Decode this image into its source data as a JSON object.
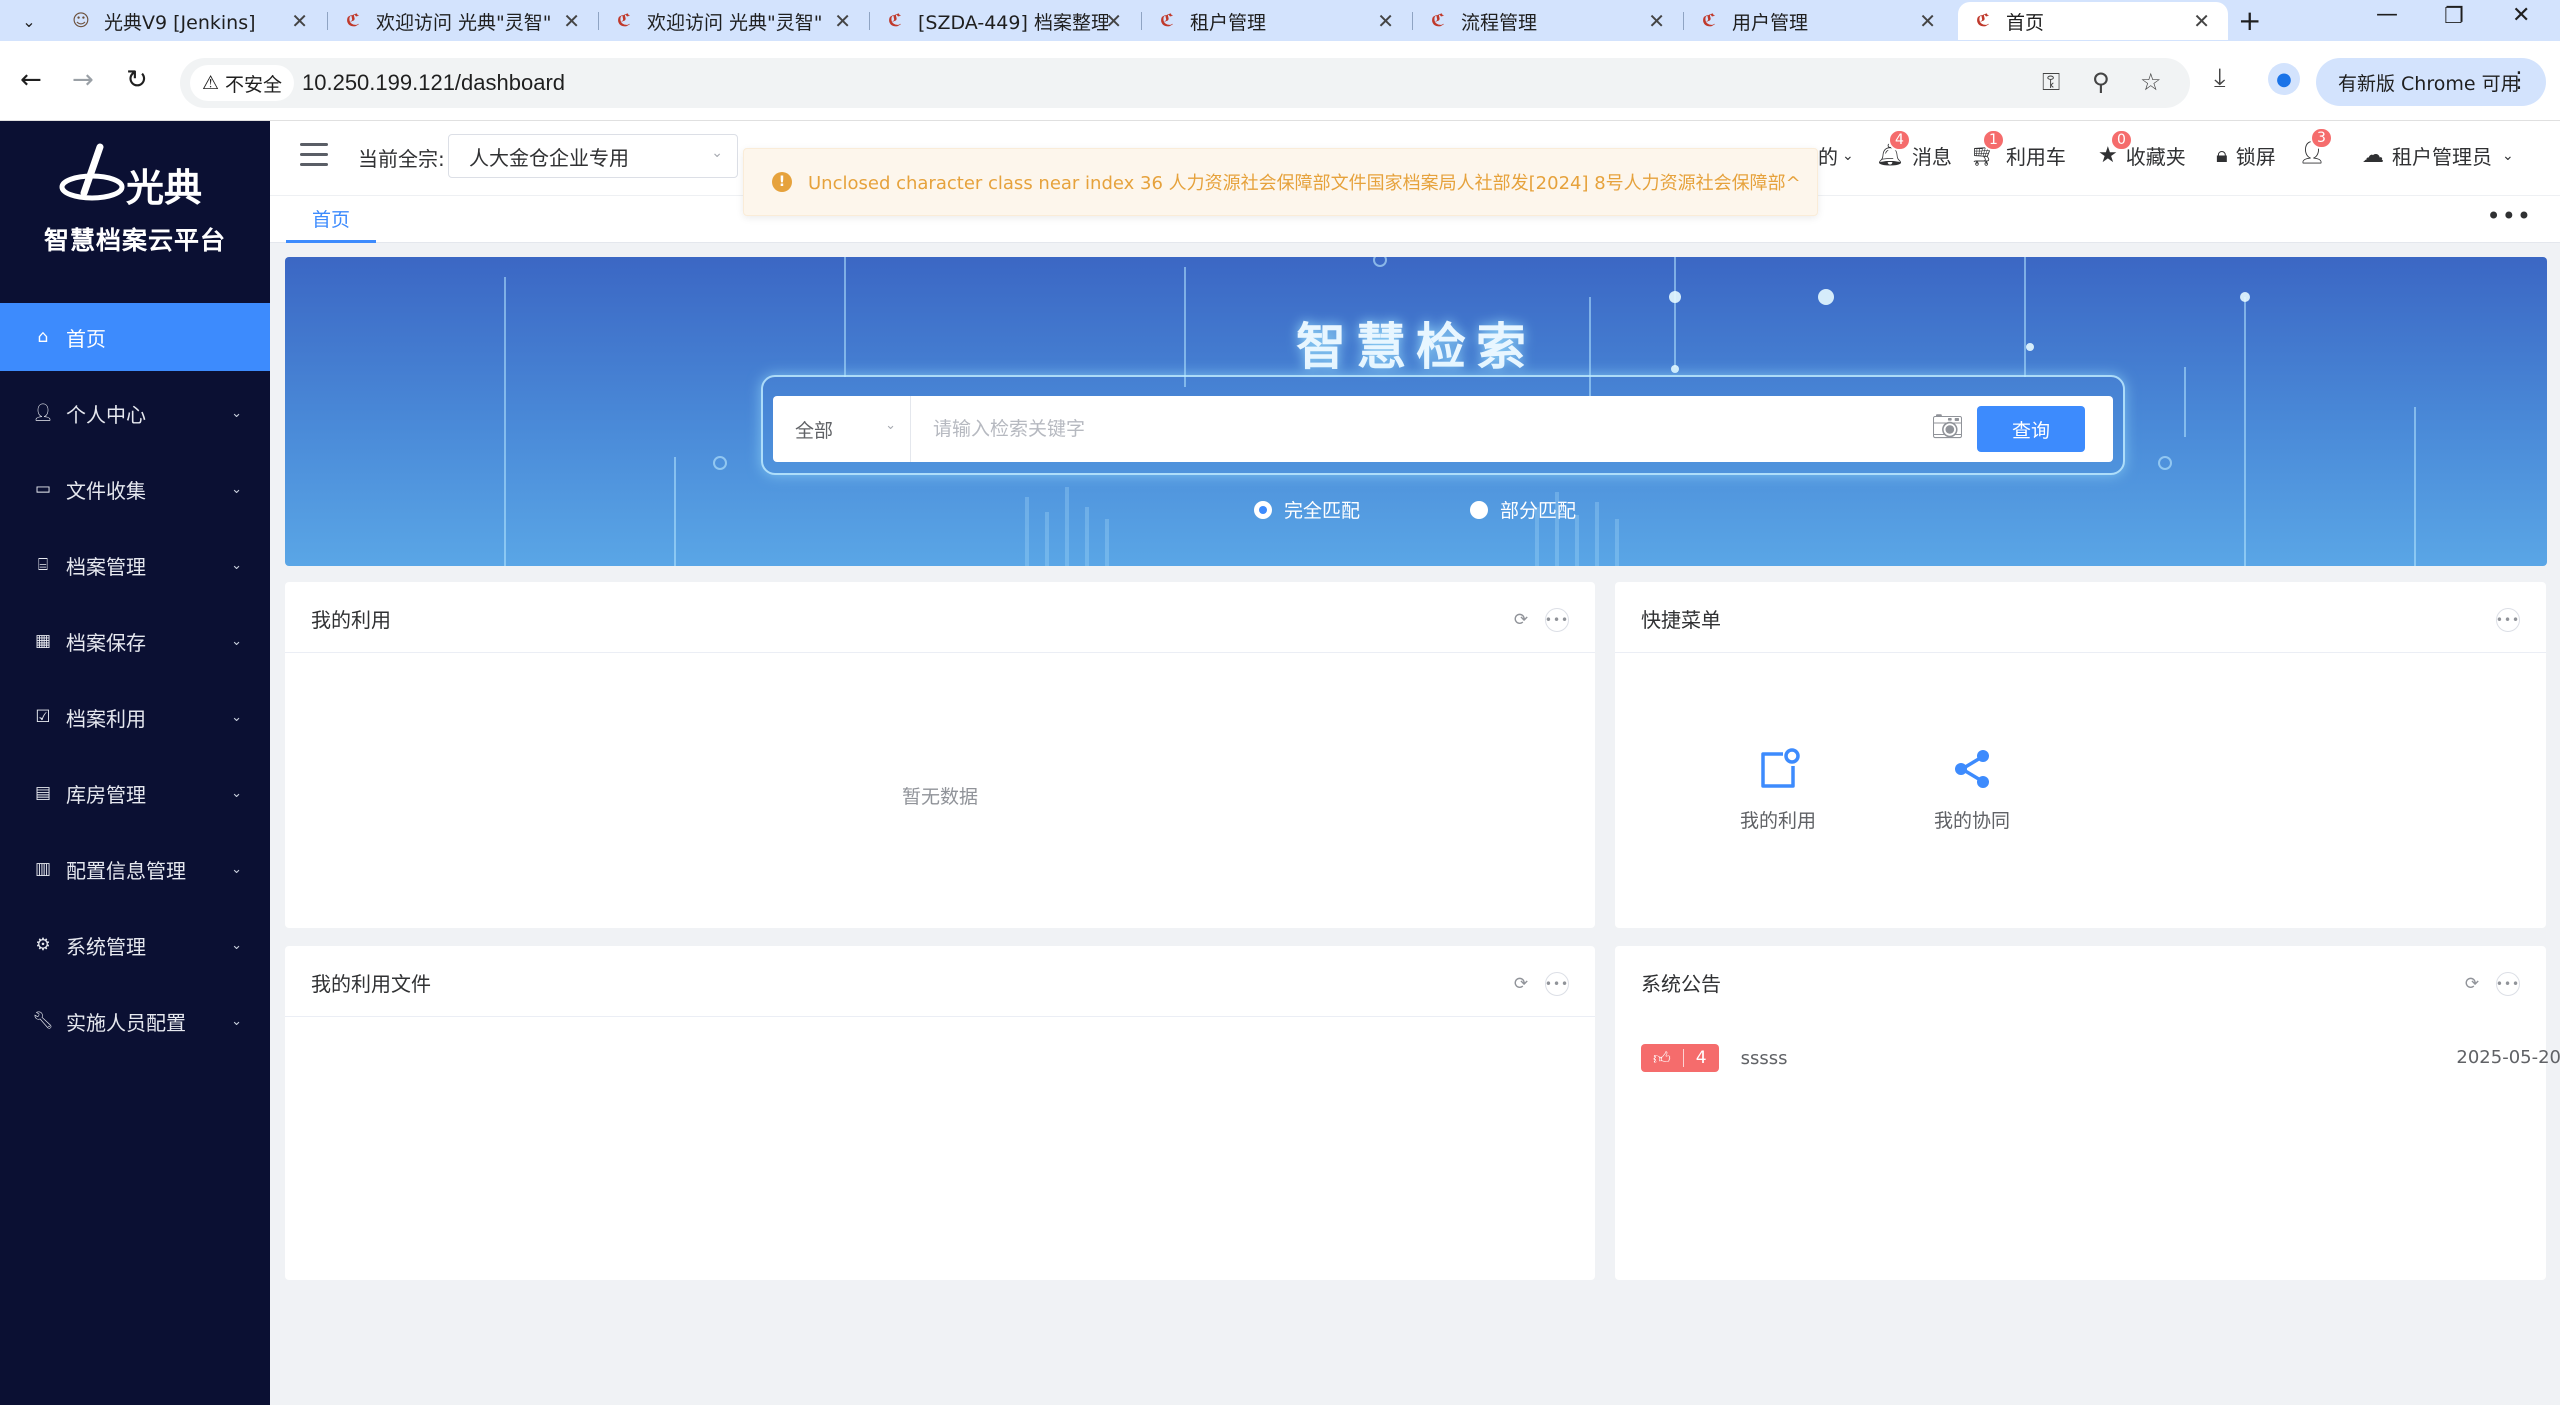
{
  "browser": {
    "tabs": [
      {
        "title": "光典V9 [Jenkins]"
      },
      {
        "title": "欢迎访问 光典\"灵智\""
      },
      {
        "title": "欢迎访问 光典\"灵智\""
      },
      {
        "title": "[SZDA-449] 档案整理"
      },
      {
        "title": "租户管理"
      },
      {
        "title": "流程管理"
      },
      {
        "title": "用户管理"
      },
      {
        "title": "首页"
      }
    ],
    "security_label": "不安全",
    "url": "10.250.199.121/dashboard",
    "update_label": "有新版 Chrome 可用"
  },
  "sidebar": {
    "platform_name": "智慧档案云平台",
    "logo_text": "光典",
    "items": [
      {
        "label": "首页",
        "icon": "home-icon"
      },
      {
        "label": "个人中心",
        "icon": "user-icon"
      },
      {
        "label": "文件收集",
        "icon": "briefcase-icon"
      },
      {
        "label": "档案管理",
        "icon": "bank-icon"
      },
      {
        "label": "档案保存",
        "icon": "building-icon"
      },
      {
        "label": "档案利用",
        "icon": "clipboard-check-icon"
      },
      {
        "label": "库房管理",
        "icon": "warehouse-icon"
      },
      {
        "label": "配置信息管理",
        "icon": "list-icon"
      },
      {
        "label": "系统管理",
        "icon": "gear-icon"
      },
      {
        "label": "实施人员配置",
        "icon": "wrench-icon"
      }
    ]
  },
  "header": {
    "tenant_label": "当前全宗:",
    "tenant_value": "人大金仓企业专用",
    "partial_label": "的",
    "messages_label": "消息",
    "messages_count": "4",
    "cart_label": "利用车",
    "cart_count": "1",
    "favorites_label": "收藏夹",
    "favorites_count": "0",
    "lock_label": "锁屏",
    "user_count": "3",
    "user_name": "租户管理员"
  },
  "alert": {
    "message": "Unclosed character class near index 36 人力资源社会保障部文件国家档案局人社部发[2024] 8号人力资源社会保障部^"
  },
  "tags": {
    "home": "首页"
  },
  "banner": {
    "title": "智慧检索",
    "scope": "全部",
    "placeholder": "请输入检索关键字",
    "search_button": "查询",
    "match_exact": "完全匹配",
    "match_partial": "部分匹配"
  },
  "cards": {
    "my_use": {
      "title": "我的利用",
      "empty": "暂无数据"
    },
    "quick_menu": {
      "title": "快捷菜单",
      "items": [
        {
          "label": "我的利用",
          "icon": "document-badge-icon"
        },
        {
          "label": "我的协同",
          "icon": "share-icon"
        }
      ]
    },
    "my_files": {
      "title": "我的利用文件"
    },
    "notice": {
      "title": "系统公告",
      "items": [
        {
          "likes": "4",
          "text": "sssss",
          "date": "2025-05-20"
        }
      ]
    }
  },
  "colors": {
    "primary": "#3d8bfd",
    "sidebar_bg": "#0b1033",
    "badge": "#f56c6c",
    "warning": "#e6a23c"
  }
}
